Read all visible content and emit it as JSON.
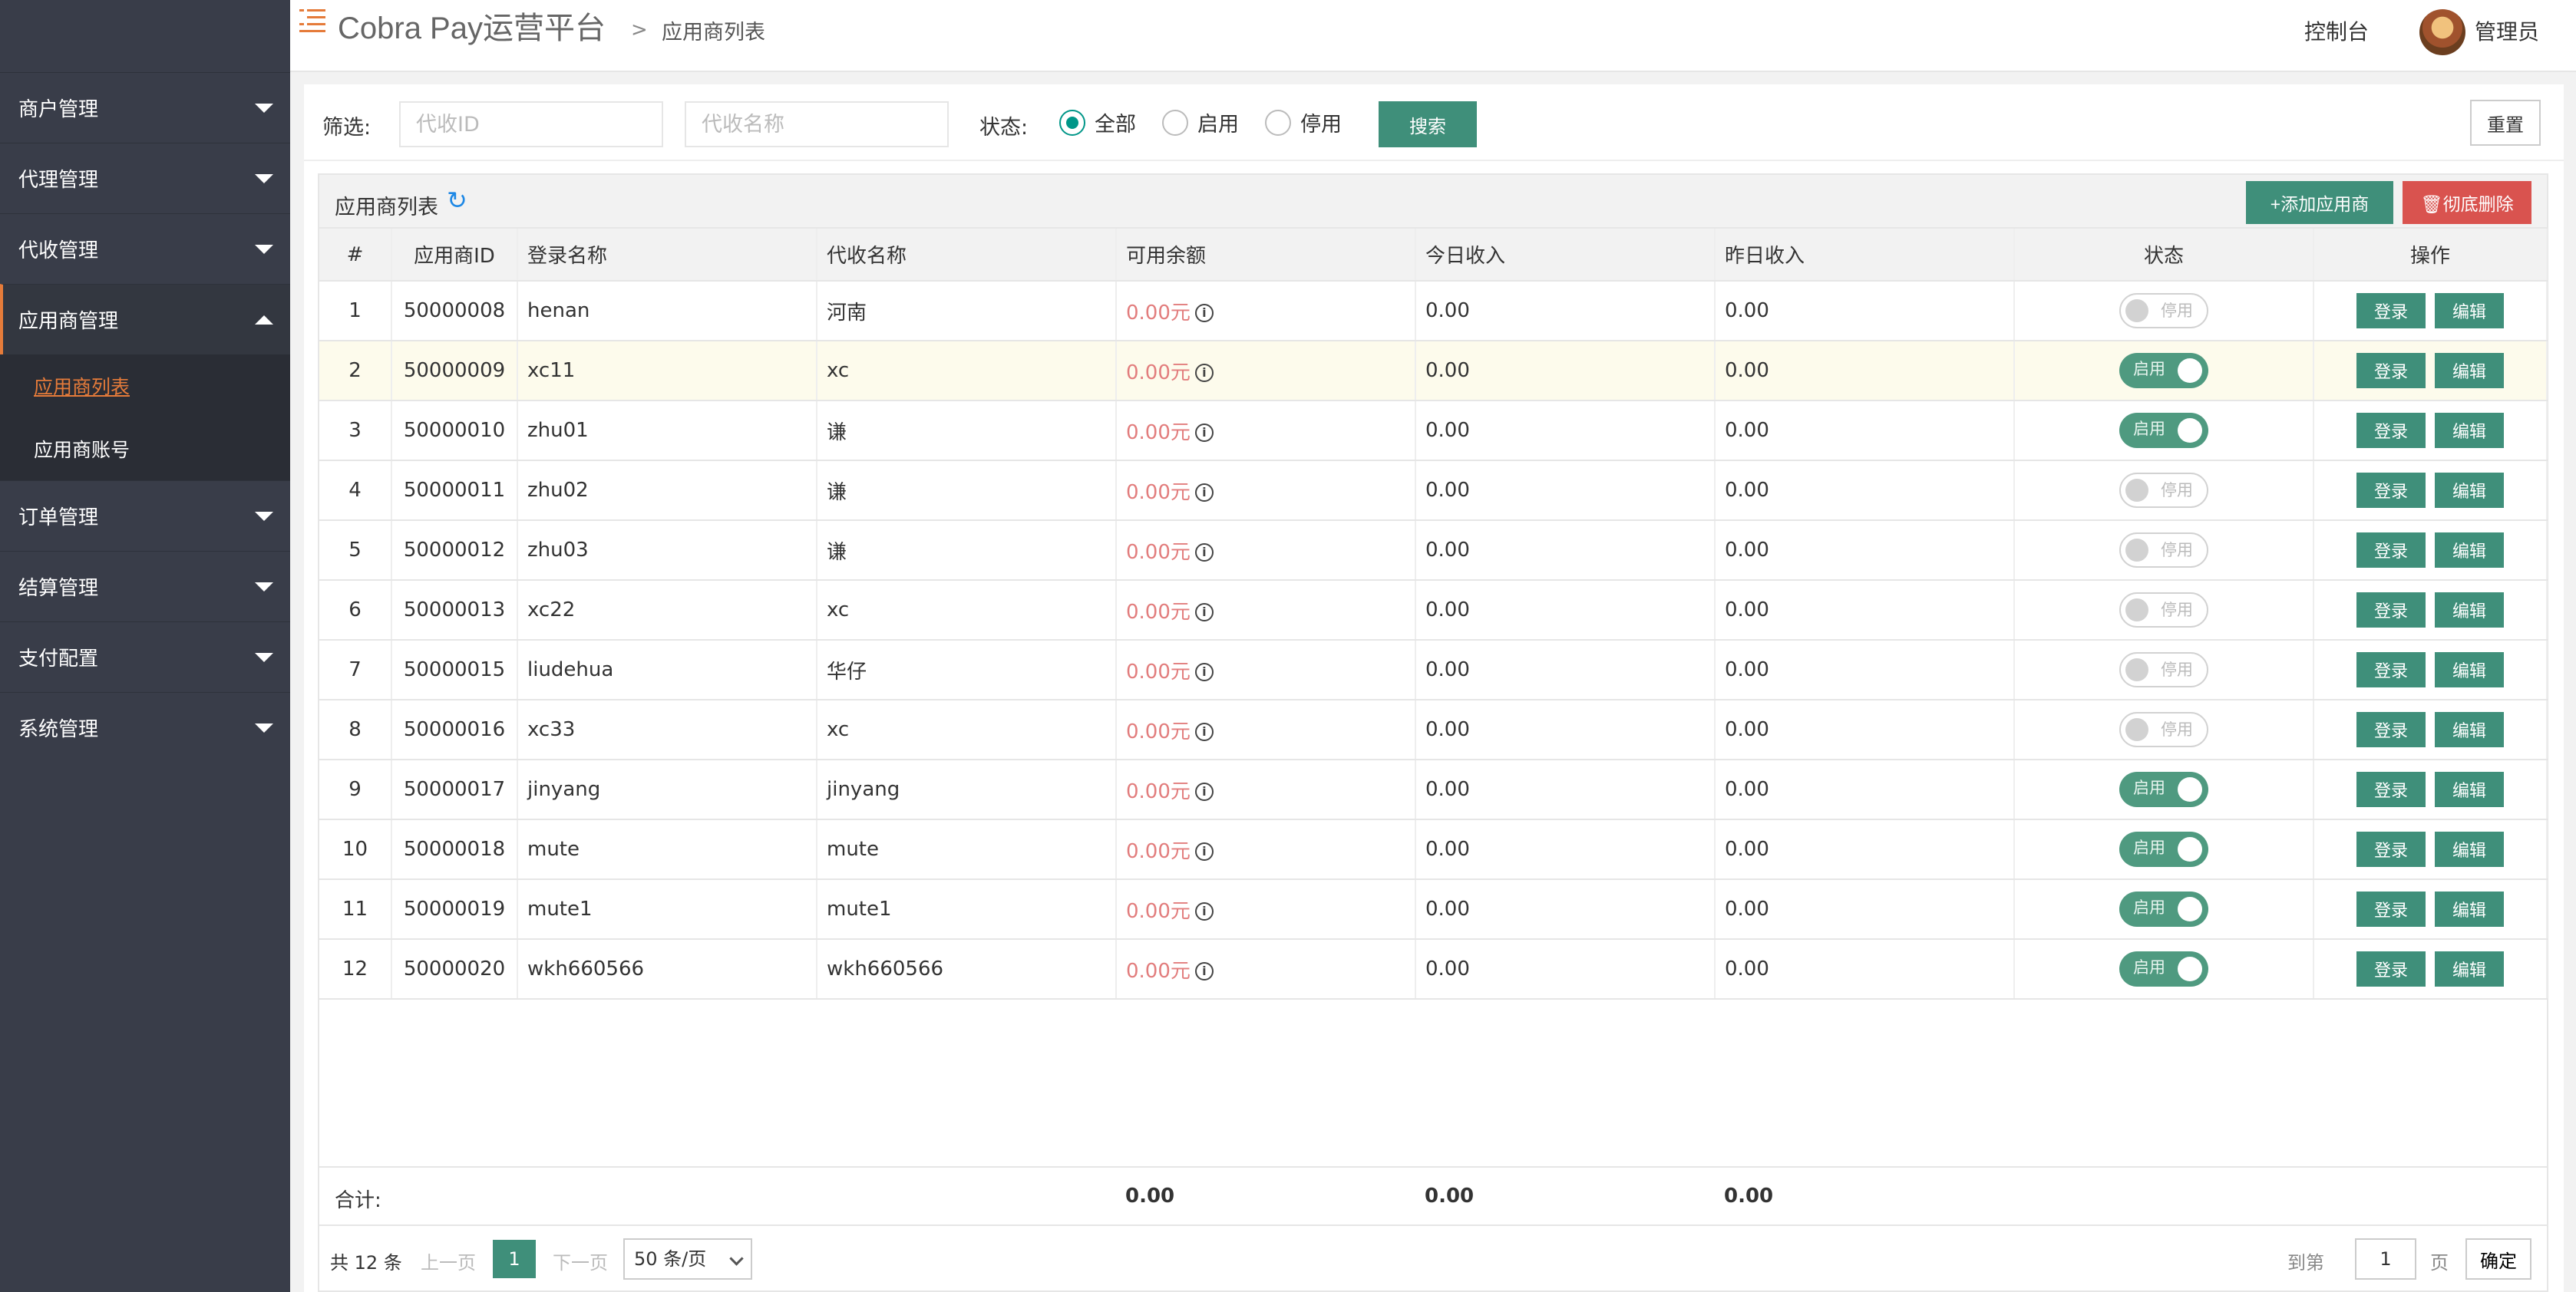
{
  "header": {
    "brand": "Cobra Pay运营平台",
    "crumb_sep": ">",
    "breadcrumb": "应用商列表",
    "console": "控制台",
    "admin": "管理员"
  },
  "sidebar": {
    "items": [
      {
        "label": "商户管理"
      },
      {
        "label": "代理管理"
      },
      {
        "label": "代收管理"
      },
      {
        "label": "应用商管理",
        "open": true,
        "children": [
          {
            "label": "应用商列表",
            "active": true
          },
          {
            "label": "应用商账号"
          }
        ]
      },
      {
        "label": "订单管理"
      },
      {
        "label": "结算管理"
      },
      {
        "label": "支付配置"
      },
      {
        "label": "系统管理"
      }
    ]
  },
  "filter": {
    "label": "筛选:",
    "id_placeholder": "代收ID",
    "name_placeholder": "代收名称",
    "status_label": "状态:",
    "options": [
      "全部",
      "启用",
      "停用"
    ],
    "selected": "全部",
    "search": "搜索",
    "reset": "重置"
  },
  "table": {
    "title": "应用商列表",
    "add_button": "添加应用商",
    "delete_button": "彻底删除",
    "headers": [
      "#",
      "应用商ID",
      "登录名称",
      "代收名称",
      "可用余额",
      "今日收入",
      "昨日收入",
      "状态",
      "操作"
    ],
    "rows": [
      {
        "n": "1",
        "id": "50000008",
        "login": "henan",
        "name": "河南",
        "balance": "0.00元",
        "today": "0.00",
        "yesterday": "0.00",
        "on": false
      },
      {
        "n": "2",
        "id": "50000009",
        "login": "xc11",
        "name": "xc",
        "balance": "0.00元",
        "today": "0.00",
        "yesterday": "0.00",
        "on": true
      },
      {
        "n": "3",
        "id": "50000010",
        "login": "zhu01",
        "name": "谦",
        "balance": "0.00元",
        "today": "0.00",
        "yesterday": "0.00",
        "on": true
      },
      {
        "n": "4",
        "id": "50000011",
        "login": "zhu02",
        "name": "谦",
        "balance": "0.00元",
        "today": "0.00",
        "yesterday": "0.00",
        "on": false
      },
      {
        "n": "5",
        "id": "50000012",
        "login": "zhu03",
        "name": "谦",
        "balance": "0.00元",
        "today": "0.00",
        "yesterday": "0.00",
        "on": false
      },
      {
        "n": "6",
        "id": "50000013",
        "login": "xc22",
        "name": "xc",
        "balance": "0.00元",
        "today": "0.00",
        "yesterday": "0.00",
        "on": false
      },
      {
        "n": "7",
        "id": "50000015",
        "login": "liudehua",
        "name": "华仔",
        "balance": "0.00元",
        "today": "0.00",
        "yesterday": "0.00",
        "on": false
      },
      {
        "n": "8",
        "id": "50000016",
        "login": "xc33",
        "name": "xc",
        "balance": "0.00元",
        "today": "0.00",
        "yesterday": "0.00",
        "on": false
      },
      {
        "n": "9",
        "id": "50000017",
        "login": "jinyang",
        "name": "jinyang",
        "balance": "0.00元",
        "today": "0.00",
        "yesterday": "0.00",
        "on": true
      },
      {
        "n": "10",
        "id": "50000018",
        "login": "mute",
        "name": "mute",
        "balance": "0.00元",
        "today": "0.00",
        "yesterday": "0.00",
        "on": true
      },
      {
        "n": "11",
        "id": "50000019",
        "login": "mute1",
        "name": "mute1",
        "balance": "0.00元",
        "today": "0.00",
        "yesterday": "0.00",
        "on": true
      },
      {
        "n": "12",
        "id": "50000020",
        "login": "wkh660566",
        "name": "wkh660566",
        "balance": "0.00元",
        "today": "0.00",
        "yesterday": "0.00",
        "on": true
      }
    ],
    "on_label": "启用",
    "off_label": "停用",
    "login_btn": "登录",
    "edit_btn": "编辑",
    "sum_label": "合计:",
    "sum_balance": "0.00",
    "sum_today": "0.00",
    "sum_yesterday": "0.00"
  },
  "pager": {
    "total": "共 12 条",
    "prev": "上一页",
    "current": "1",
    "next": "下一页",
    "page_size": "50 条/页",
    "goto": "到第",
    "goto_value": "1",
    "page_unit": "页",
    "confirm": "确定"
  },
  "colors": {
    "accent": "#3f8f7a",
    "danger": "#d9534f",
    "menu_active": "#e57b3a"
  }
}
